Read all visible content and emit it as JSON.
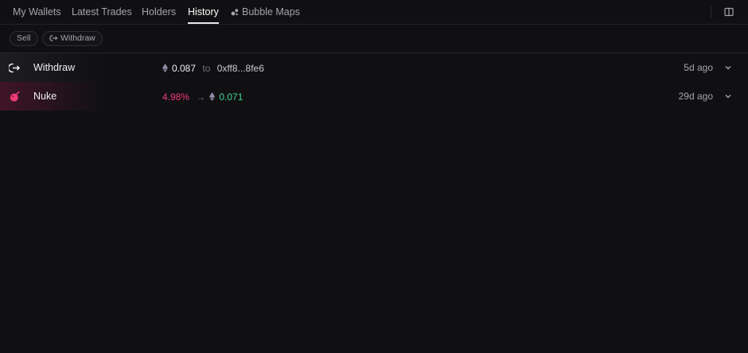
{
  "tabs": [
    {
      "label": "My Wallets"
    },
    {
      "label": "Latest Trades"
    },
    {
      "label": "Holders"
    },
    {
      "label": "History",
      "active": true
    },
    {
      "label": "Bubble Maps",
      "icon": "bubbles-icon"
    }
  ],
  "filters": [
    {
      "label": "Sell"
    },
    {
      "label": "Withdraw",
      "icon": "withdraw-icon"
    }
  ],
  "history": [
    {
      "type": "Withdraw",
      "icon": "withdraw-icon",
      "amount": "0.087",
      "connector": "to",
      "address": "0xff8...8fe6",
      "time": "5d ago"
    },
    {
      "type": "Nuke",
      "icon": "bomb-icon",
      "percent": "4.98%",
      "arrow": "→",
      "amount": "0.071",
      "time": "29d ago"
    }
  ],
  "colors": {
    "background": "#101013",
    "accent_pink": "#ef3a74",
    "accent_green": "#3fd48e",
    "muted_text": "#a3a3ad"
  }
}
